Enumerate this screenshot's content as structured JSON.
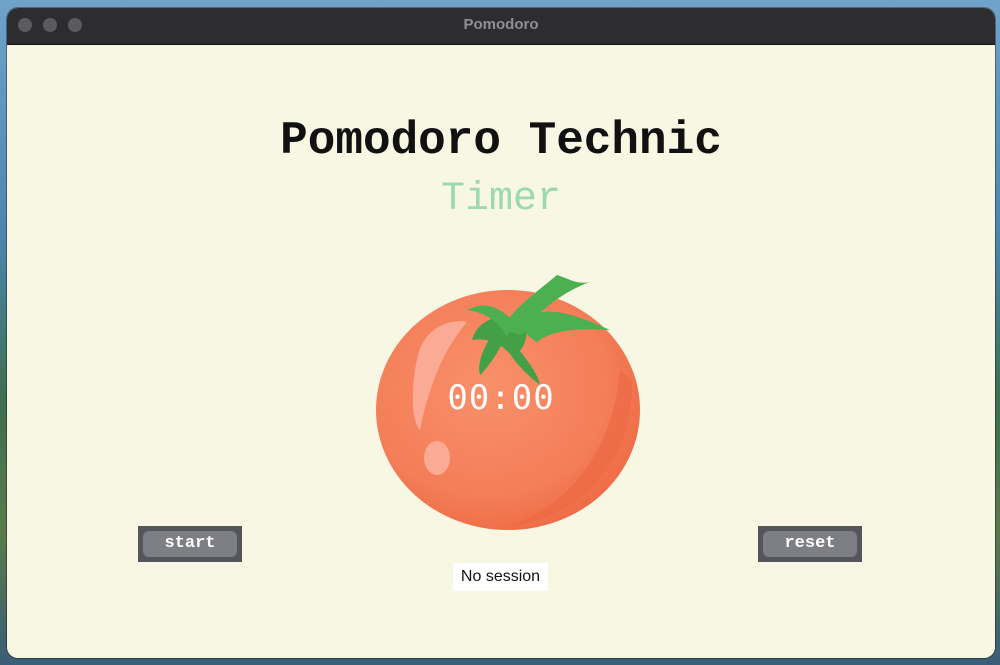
{
  "window": {
    "title": "Pomodoro"
  },
  "app": {
    "heading": "Pomodoro Technic",
    "subheading": "Timer",
    "timer": "00:00",
    "status": "No session"
  },
  "buttons": {
    "start_label": "start",
    "reset_label": "reset"
  },
  "colors": {
    "background": "#f8f7e4",
    "subheading": "#9bd9b1",
    "tomato": "#f47a55",
    "leaf": "#4caf50",
    "button": "#7e7f84"
  }
}
